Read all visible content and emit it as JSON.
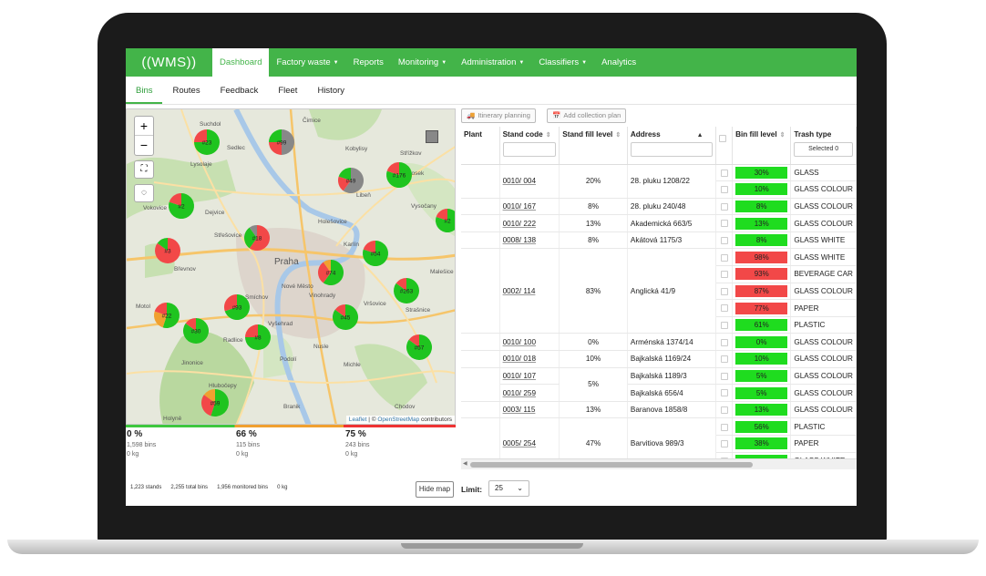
{
  "app": {
    "logo": "((WMS))"
  },
  "topnav": [
    {
      "label": "Dashboard",
      "active": true,
      "dropdown": false
    },
    {
      "label": "Factory waste",
      "dropdown": true
    },
    {
      "label": "Reports",
      "dropdown": false
    },
    {
      "label": "Monitoring",
      "dropdown": true
    },
    {
      "label": "Administration",
      "dropdown": true
    },
    {
      "label": "Classifiers",
      "dropdown": true
    },
    {
      "label": "Analytics",
      "dropdown": false
    }
  ],
  "subtabs": [
    {
      "label": "Bins",
      "active": true
    },
    {
      "label": "Routes"
    },
    {
      "label": "Feedback"
    },
    {
      "label": "Fleet"
    },
    {
      "label": "History"
    }
  ],
  "map": {
    "zoom_in": "+",
    "zoom_out": "−",
    "attribution_leaflet": "Leaflet",
    "attribution_sep": " | © ",
    "attribution_osm": "OpenStreetMap",
    "attribution_tail": " contributors",
    "places": [
      "Čimice",
      "Suchdol",
      "Sedlec",
      "Lysolaje",
      "Kobylisy",
      "Střížkov",
      "Prosek",
      "Dejvice",
      "Vokovice",
      "Holešovice",
      "Libeň",
      "Vysočany",
      "Střešovice",
      "Břevnov",
      "Praha",
      "Karlín",
      "Malešice",
      "Nové Město",
      "Vinohrady",
      "Smíchov",
      "Vršovice",
      "Strašnice",
      "Motol",
      "Vyšehrad",
      "Radlice",
      "Nusle",
      "Jinonice",
      "Podolí",
      "Michle",
      "Hlubočepy",
      "Branik",
      "Chodov",
      "Holyně"
    ],
    "clusters": [
      {
        "label": "#23",
        "colors": [
          "#1fc41f",
          "#f24848"
        ]
      },
      {
        "label": "#99",
        "colors": [
          "#888888",
          "#f24848",
          "#1fc41f"
        ]
      },
      {
        "label": "#49",
        "colors": [
          "#888888",
          "#f24848",
          "#1fc41f"
        ]
      },
      {
        "label": "#176",
        "colors": [
          "#1fc41f",
          "#f24848"
        ]
      },
      {
        "label": "#2",
        "colors": [
          "#1fc41f",
          "#f24848"
        ]
      },
      {
        "label": "#3",
        "colors": [
          "#f24848",
          "#1fc41f"
        ]
      },
      {
        "label": "#18",
        "colors": [
          "#f24848",
          "#1fc41f",
          "#888888"
        ]
      },
      {
        "label": "#54",
        "colors": [
          "#1fc41f",
          "#f24848"
        ]
      },
      {
        "label": "#74",
        "colors": [
          "#1fc41f",
          "#f24848",
          "#f0a030"
        ]
      },
      {
        "label": "#263",
        "colors": [
          "#1fc41f",
          "#f24848"
        ]
      },
      {
        "label": "#22",
        "colors": [
          "#1fc41f",
          "#f0a030",
          "#f24848"
        ]
      },
      {
        "label": "#93",
        "colors": [
          "#1fc41f",
          "#f24848"
        ]
      },
      {
        "label": "#30",
        "colors": [
          "#1fc41f",
          "#f24848"
        ]
      },
      {
        "label": "#45",
        "colors": [
          "#1fc41f",
          "#f24848"
        ]
      },
      {
        "label": "#8",
        "colors": [
          "#1fc41f",
          "#f24848"
        ]
      },
      {
        "label": "#57",
        "colors": [
          "#1fc41f",
          "#f24848"
        ]
      },
      {
        "label": "#59",
        "colors": [
          "#1fc41f",
          "#f24848",
          "#f0a030"
        ]
      },
      {
        "label": "#2",
        "colors": [
          "#1fc41f",
          "#f24848"
        ]
      }
    ]
  },
  "stats": [
    {
      "pct": "0 %",
      "bins": "1,598 bins",
      "kg": "0 kg"
    },
    {
      "pct": "66 %",
      "bins": "115 bins",
      "kg": "0 kg"
    },
    {
      "pct": "75 %",
      "bins": "243 bins",
      "kg": "0 kg"
    }
  ],
  "footer": {
    "stands": "1,223 stands",
    "total_bins": "2,255 total bins",
    "monitored": "1,956 monitored bins",
    "kg": "0 kg",
    "hide_map": "Hide map",
    "limit_label": "Limit:",
    "limit_value": "25"
  },
  "toolbar": {
    "itinerary": "Itinerary planning",
    "add_plan": "Add collection plan"
  },
  "table": {
    "headers": {
      "plant": "Plant",
      "stand_code": "Stand code",
      "stand_fill": "Stand fill level",
      "address": "Address",
      "bin_fill": "Bin fill level",
      "trash_type": "Trash type",
      "trash_filter": "Selected 0"
    },
    "colors": {
      "green": "#1fdc1f",
      "red": "#f24848"
    },
    "rows": [
      {
        "code": "0010/ 004",
        "stand_fill": "20%",
        "address": "28. pluku 1208/22",
        "bins": [
          {
            "level": "30%",
            "status": "green",
            "type": "GLASS"
          },
          {
            "level": "10%",
            "status": "green",
            "type": "GLASS COLOUR"
          }
        ]
      },
      {
        "code": "0010/ 167",
        "stand_fill": "8%",
        "address": "28. pluku 240/48",
        "bins": [
          {
            "level": "8%",
            "status": "green",
            "type": "GLASS COLOUR"
          }
        ]
      },
      {
        "code": "0010/ 222",
        "stand_fill": "13%",
        "address": "Akademická 663/5",
        "bins": [
          {
            "level": "13%",
            "status": "green",
            "type": "GLASS COLOUR"
          }
        ]
      },
      {
        "code": "0008/ 138",
        "stand_fill": "8%",
        "address": "Akátová 1175/3",
        "bins": [
          {
            "level": "8%",
            "status": "green",
            "type": "GLASS WHITE"
          }
        ]
      },
      {
        "code": "0002/ 114",
        "stand_fill": "83%",
        "address": "Anglická 41/9",
        "bins": [
          {
            "level": "98%",
            "status": "red",
            "type": "GLASS WHITE"
          },
          {
            "level": "93%",
            "status": "red",
            "type": "BEVERAGE CAR"
          },
          {
            "level": "87%",
            "status": "red",
            "type": "GLASS COLOUR"
          },
          {
            "level": "77%",
            "status": "red",
            "type": "PAPER"
          },
          {
            "level": "61%",
            "status": "green",
            "type": "PLASTIC"
          }
        ]
      },
      {
        "code": "0010/ 100",
        "stand_fill": "0%",
        "address": "Arménská 1374/14",
        "bins": [
          {
            "level": "0%",
            "status": "green",
            "type": "GLASS COLOUR"
          }
        ]
      },
      {
        "code": "0010/ 018",
        "stand_fill": "10%",
        "address": "Bajkalská 1169/24",
        "bins": [
          {
            "level": "10%",
            "status": "green",
            "type": "GLASS COLOUR"
          }
        ]
      },
      {
        "codes": [
          "0010/ 107",
          "0010/ 259"
        ],
        "stand_fill": "5%",
        "addresses": [
          "Bajkalská 1189/3",
          "Bajkalská 656/4"
        ],
        "bins": [
          {
            "level": "5%",
            "status": "green",
            "type": "GLASS COLOUR"
          },
          {
            "level": "5%",
            "status": "green",
            "type": "GLASS COLOUR"
          }
        ]
      },
      {
        "code": "0003/ 115",
        "stand_fill": "13%",
        "address": "Baranova 1858/8",
        "bins": [
          {
            "level": "13%",
            "status": "green",
            "type": "GLASS COLOUR"
          }
        ]
      },
      {
        "code": "0005/ 254",
        "stand_fill": "47%",
        "address": "Barvitiova 989/3",
        "bins": [
          {
            "level": "56%",
            "status": "green",
            "type": "PLASTIC"
          },
          {
            "level": "38%",
            "status": "green",
            "type": "PAPER"
          },
          {
            "level": "",
            "status": "green",
            "type": "GLASS WHITE"
          }
        ]
      }
    ]
  }
}
